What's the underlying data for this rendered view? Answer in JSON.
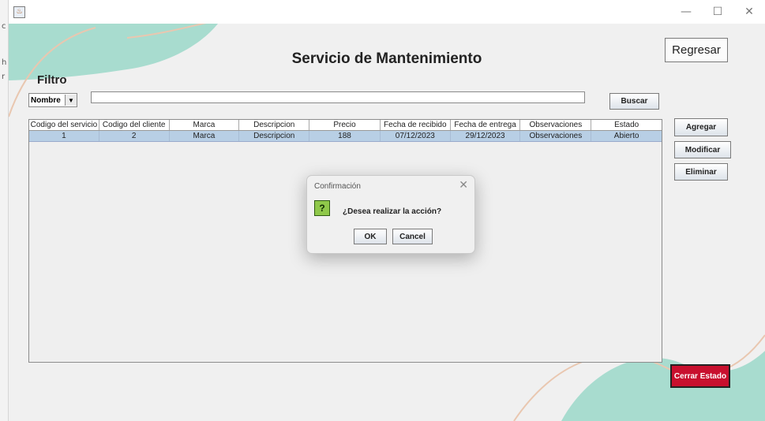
{
  "window": {
    "title": "",
    "controls": {
      "minimize": "—",
      "maximize": "☐",
      "close": "✕"
    }
  },
  "header": {
    "title": "Servicio de Mantenimiento",
    "back_label": "Regresar"
  },
  "filter": {
    "label": "Filtro",
    "field_selected": "Nombre",
    "search_value": "",
    "search_button": "Buscar"
  },
  "table": {
    "columns": [
      "Codigo del servicio",
      "Codigo del cliente",
      "Marca",
      "Descripcion",
      "Precio",
      "Fecha de recibido",
      "Fecha de entrega",
      "Observaciones",
      "Estado"
    ],
    "rows": [
      [
        "1",
        "2",
        "Marca",
        "Descripcion",
        "188",
        "07/12/2023",
        "29/12/2023",
        "Observaciones",
        "Abierto"
      ]
    ]
  },
  "actions": {
    "add": "Agregar",
    "modify": "Modificar",
    "delete": "Eliminar",
    "close_state": "Cerrar Estado"
  },
  "dialog": {
    "title": "Confirmación",
    "icon": "?",
    "message": "¿Desea realizar la acción?",
    "ok": "OK",
    "cancel": "Cancel"
  },
  "colors": {
    "accent_mint": "#a8dccf",
    "accent_peach": "#e9c7b0",
    "close_state_bg": "#c8102e",
    "selected_row": "#b8cfe5"
  },
  "icons": {
    "app": "java-icon",
    "dialog": "question-icon"
  }
}
